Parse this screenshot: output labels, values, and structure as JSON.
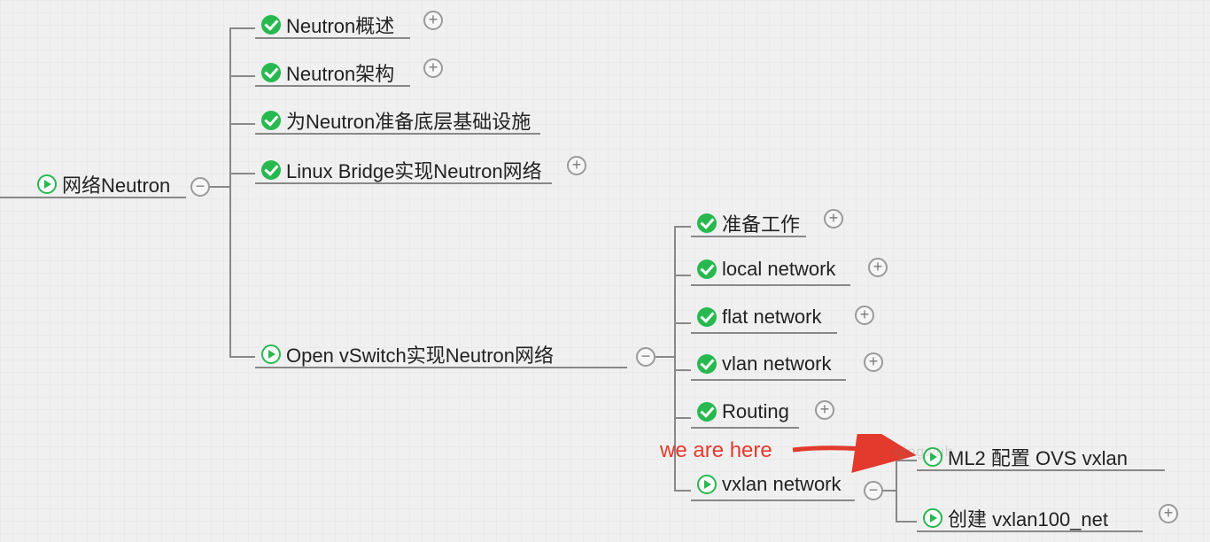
{
  "root": {
    "label": "网络Neutron"
  },
  "level2": {
    "n1": {
      "label": "Neutron概述"
    },
    "n2": {
      "label": "Neutron架构"
    },
    "n3": {
      "label": "为Neutron准备底层基础设施"
    },
    "n4": {
      "label": "Linux Bridge实现Neutron网络"
    },
    "n5": {
      "label": "Open vSwitch实现Neutron网络"
    }
  },
  "level3": {
    "m1": {
      "label": "准备工作"
    },
    "m2": {
      "label": "local network"
    },
    "m3": {
      "label": "flat network"
    },
    "m4": {
      "label": "vlan network"
    },
    "m5": {
      "label": "Routing"
    },
    "m6": {
      "label": "vxlan network"
    }
  },
  "level4": {
    "k1": {
      "label": "ML2 配置 OVS vxlan"
    },
    "k2": {
      "label": "创建 vxlan100_net"
    }
  },
  "annotation": {
    "text": "we are here"
  },
  "watermark": {
    "text": "qingwuh "
  }
}
